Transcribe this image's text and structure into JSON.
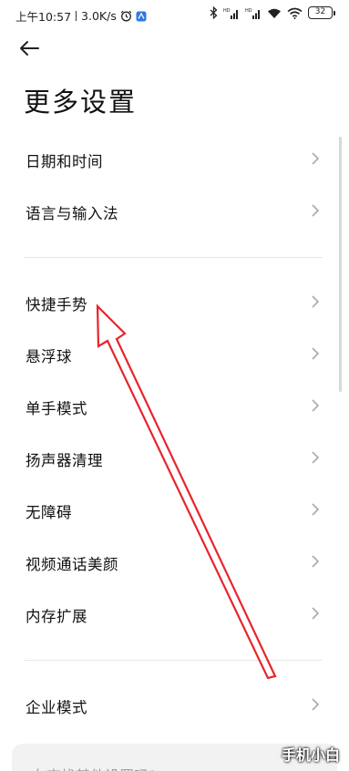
{
  "status_bar": {
    "time": "上午10:57",
    "network_speed": "3.0K/s",
    "battery": "32",
    "icons": [
      "alarm-icon",
      "app-notification-icon",
      "bluetooth-icon",
      "hd-signal-icon",
      "hd-signal-icon",
      "wifi-call-icon",
      "wifi-icon",
      "battery-icon"
    ]
  },
  "header": {
    "back_icon": "back-arrow-icon",
    "title": "更多设置"
  },
  "groups": [
    {
      "items": [
        {
          "label": "日期和时间"
        },
        {
          "label": "语言与输入法"
        }
      ]
    },
    {
      "items": [
        {
          "label": "快捷手势"
        },
        {
          "label": "悬浮球"
        },
        {
          "label": "单手模式"
        },
        {
          "label": "扬声器清理"
        },
        {
          "label": "无障碍"
        },
        {
          "label": "视频通话美颜"
        },
        {
          "label": "内存扩展"
        }
      ]
    },
    {
      "items": [
        {
          "label": "企业模式"
        }
      ]
    }
  ],
  "search_card": {
    "text": "在查找其他设置吗?"
  },
  "watermark": "手机小白",
  "annotation": {
    "color": "#e8242b",
    "icon": "red-arrow-annotation"
  },
  "chevron_icon": "chevron-right-icon"
}
